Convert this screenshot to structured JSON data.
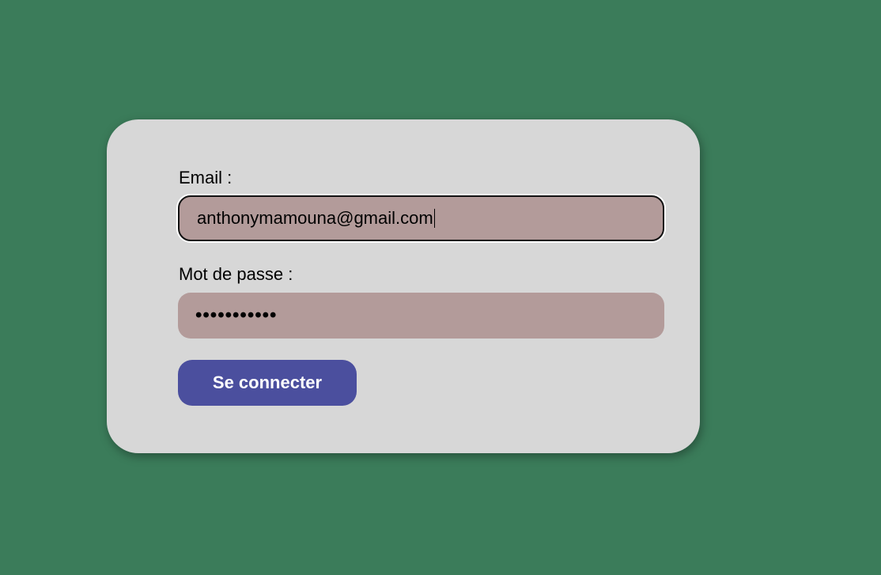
{
  "login_form": {
    "email_label": "Email :",
    "email_value": "anthonymamouna@gmail.com",
    "password_label": "Mot de passe :",
    "password_masked": "•••••••••••",
    "submit_label": "Se connecter"
  },
  "colors": {
    "page_background": "#3b7c5a",
    "card_background": "#d7d7d7",
    "input_background": "#b39b9a",
    "button_background": "#4b4f9e",
    "button_text": "#ffffff"
  }
}
